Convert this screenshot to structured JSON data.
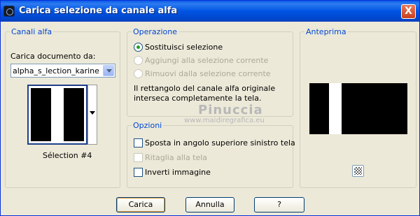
{
  "window": {
    "title": "Carica selezione da canale alfa",
    "close_label": "X"
  },
  "canali": {
    "legend": "Canali alfa",
    "doc_label": "Carica documento da:",
    "doc_value": "alpha_s_lection_karine",
    "thumb_label": "Sélection #4"
  },
  "operazione": {
    "legend": "Operazione",
    "options": [
      "Sostituisci selezione",
      "Aggiungi alla selezione corrente",
      "Rimuovi dalla selezione corrente"
    ],
    "selected_index": 0,
    "note_line1": "Il rettangolo del canale alfa originale",
    "note_line2": "interseca completamente la tela."
  },
  "opzioni": {
    "legend": "Opzioni",
    "items": [
      {
        "label": "Sposta in angolo superiore sinistro tela",
        "enabled": true,
        "checked": false
      },
      {
        "label": "Ritaglia alla tela",
        "enabled": false,
        "checked": false
      },
      {
        "label": "Inverti immagine",
        "enabled": true,
        "checked": false
      }
    ]
  },
  "anteprima": {
    "legend": "Anteprima",
    "zoom_icon": "checker-icon"
  },
  "watermark": {
    "name": "Pinuccia",
    "url": "www.maidiregrafica.eu"
  },
  "buttons": {
    "ok": "Carica",
    "cancel": "Annulla",
    "help": "?"
  },
  "colors": {
    "title_bar": "#0054e3",
    "legend_text": "#0046d5",
    "radio_dot": "#21a121"
  }
}
